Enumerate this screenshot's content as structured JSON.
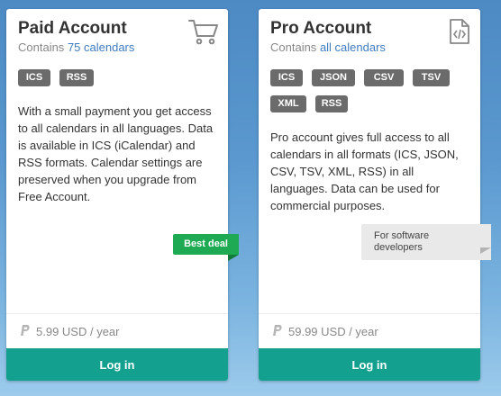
{
  "paid": {
    "title": "Paid Account",
    "subtitle_prefix": "Contains",
    "subtitle_link": "75 calendars",
    "icon": "cart-icon",
    "badges": [
      "ICS",
      "RSS"
    ],
    "description": "With a small payment you get access to all calendars in all languages. Data is available in ICS (iCalendar) and RSS formats. Calendar settings are preserved when you upgrade from Free Account.",
    "ribbon": "Best deal",
    "price": "5.99 USD / year",
    "price_icon": "paypal-icon",
    "button": "Log in"
  },
  "pro": {
    "title": "Pro Account",
    "subtitle_prefix": "Contains",
    "subtitle_link": "all calendars",
    "icon": "code-file-icon",
    "badges": [
      "ICS",
      "JSON",
      "CSV",
      "TSV",
      "XML",
      "RSS"
    ],
    "description": "Pro account gives full access to all calendars in all formats (ICS, JSON, CSV, TSV, XML, RSS) in all languages. Data can be used for commercial purposes.",
    "ribbon": "For software developers",
    "price": "59.99 USD / year",
    "price_icon": "paypal-icon",
    "button": "Log in"
  },
  "colors": {
    "accent": "#14a08f",
    "link": "#3f7cc0",
    "ribbon_green": "#1eaa52",
    "badge": "#6b6b6b"
  }
}
